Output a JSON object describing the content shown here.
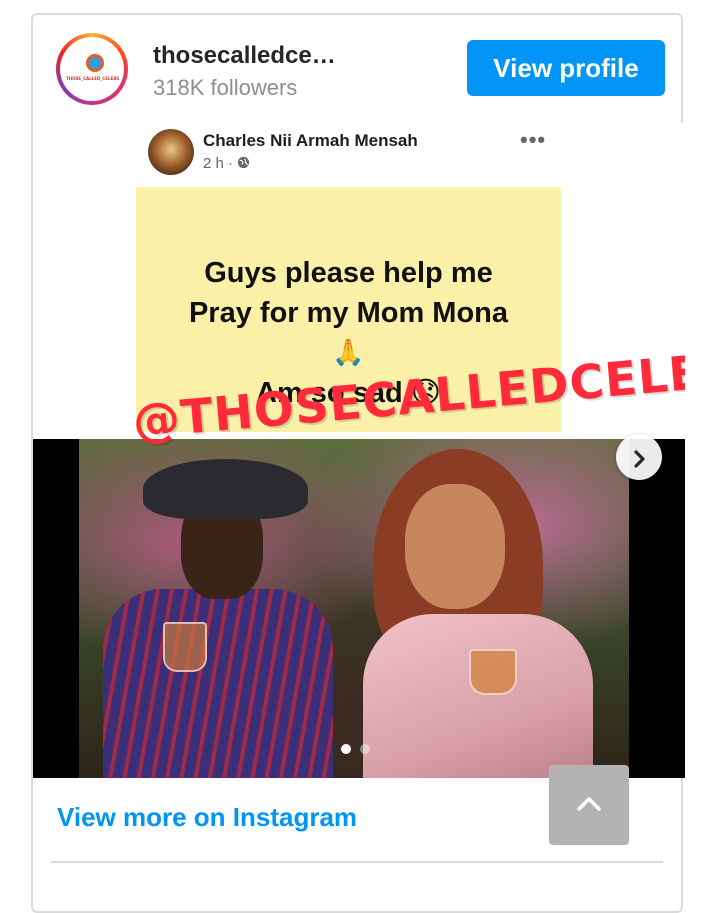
{
  "embed": {
    "username": "thosecalledce…",
    "followers": "318K followers",
    "view_profile_label": "View profile",
    "avatar_logo_text": "THOSE_CALLED_CELEBS"
  },
  "post": {
    "author": "Charles Nii Armah Mensah",
    "time": "2 h ·",
    "more_glyph": "•••",
    "lines": [
      "Guys please help me",
      "Pray for my Mom Mona",
      "🙏",
      "Am so sad 😞"
    ],
    "watermark": "@THOSECALLEDCELEBS"
  },
  "carousel": {
    "next_glyph": "›",
    "slide_count": 2,
    "active_index": 0
  },
  "footer": {
    "view_more_label": "View more on Instagram"
  },
  "colors": {
    "accent": "#0095f6",
    "post_background": "#fbf0a7",
    "watermark": "#ff2b3a"
  }
}
